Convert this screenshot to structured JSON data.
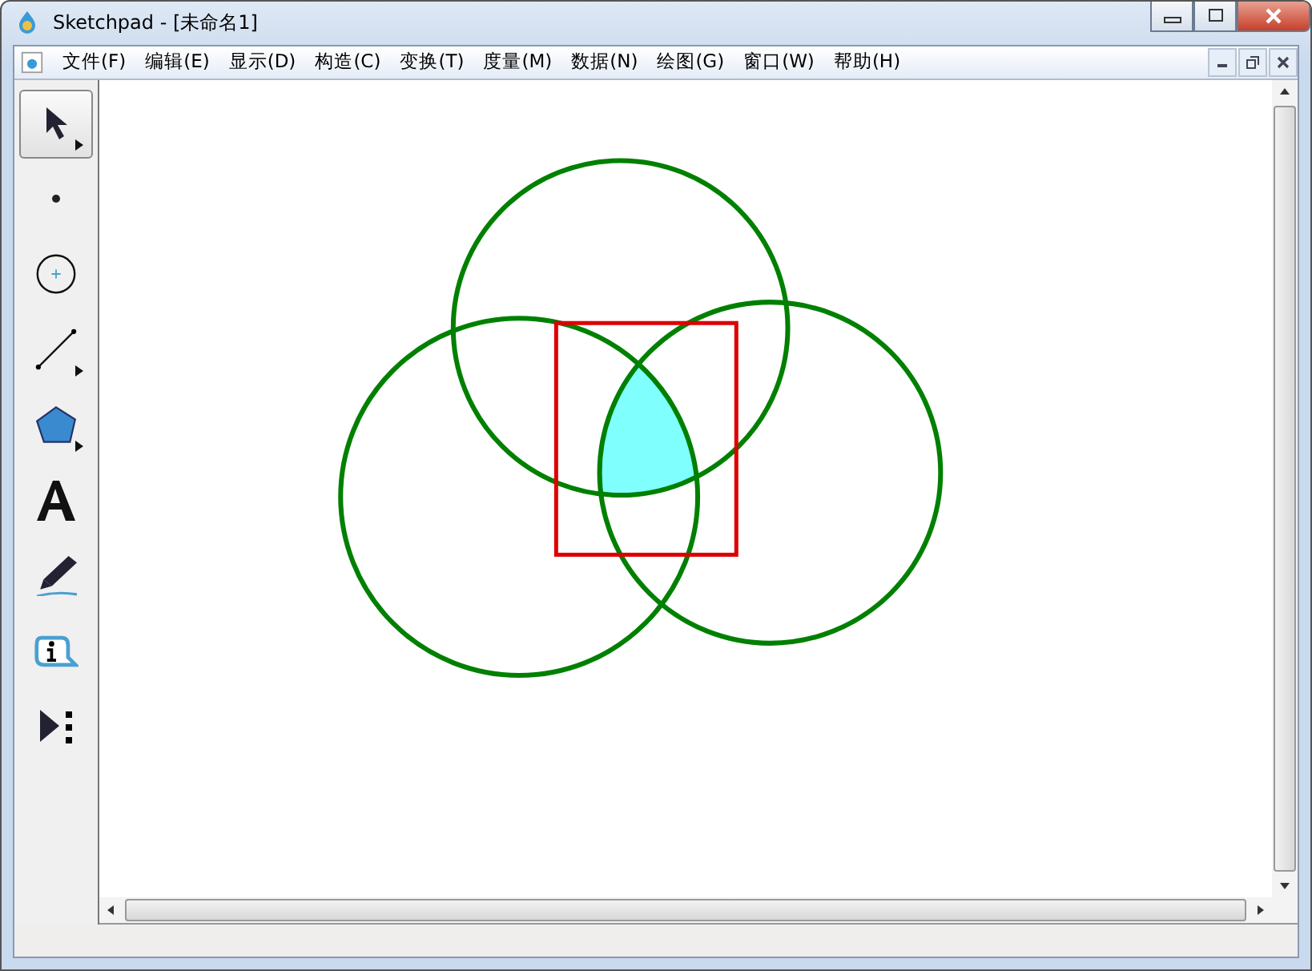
{
  "window": {
    "title": "Sketchpad  - [未命名1]"
  },
  "menu": [
    "文件(F)",
    "编辑(E)",
    "显示(D)",
    "构造(C)",
    "变换(T)",
    "度量(M)",
    "数据(N)",
    "绘图(G)",
    "窗口(W)",
    "帮助(H)"
  ],
  "tools": [
    {
      "kind": "arrow",
      "selected": true,
      "submenu": true
    },
    {
      "kind": "point",
      "selected": false,
      "submenu": false
    },
    {
      "kind": "compass",
      "selected": false,
      "submenu": false
    },
    {
      "kind": "line",
      "selected": false,
      "submenu": true
    },
    {
      "kind": "polygon",
      "selected": false,
      "submenu": true
    },
    {
      "kind": "text",
      "selected": false,
      "submenu": false
    },
    {
      "kind": "marker",
      "selected": false,
      "submenu": false
    },
    {
      "kind": "info",
      "selected": false,
      "submenu": false
    },
    {
      "kind": "custom",
      "selected": false,
      "submenu": false
    }
  ]
}
